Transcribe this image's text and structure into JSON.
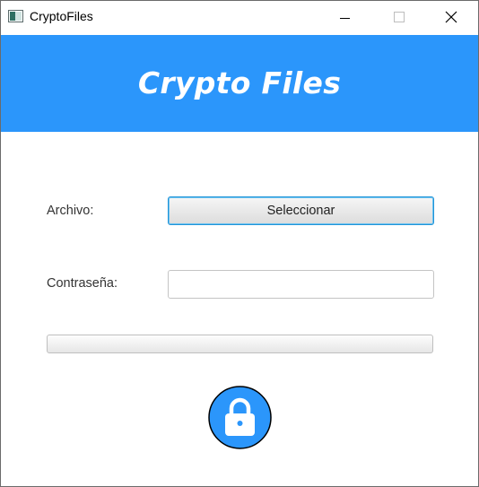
{
  "window": {
    "title": "CryptoFiles",
    "icon": "app-window-icon",
    "controls": {
      "minimize_icon": "minimize-icon",
      "maximize_icon": "maximize-icon",
      "close_icon": "close-icon"
    }
  },
  "header": {
    "title": "Crypto Files",
    "background_color": "#2b96fb"
  },
  "form": {
    "file_label": "Archivo:",
    "select_button_label": "Seleccionar",
    "password_label": "Contraseña:",
    "password_value": "",
    "progress_fraction": 0
  },
  "action": {
    "icon": "lock-icon",
    "color": "#2b96fb"
  }
}
